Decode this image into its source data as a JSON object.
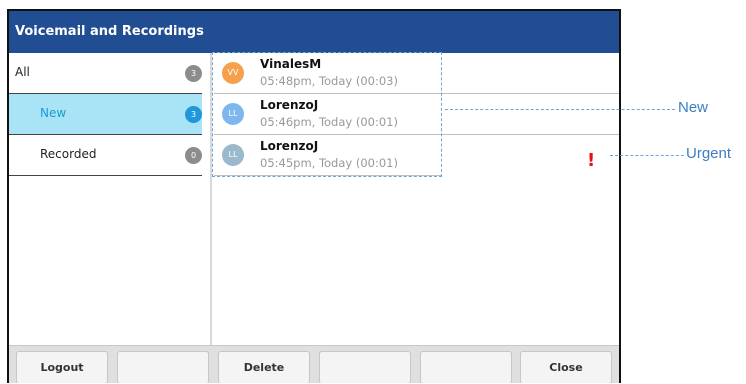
{
  "title": "Voicemail and Recordings",
  "sidebar": {
    "items": [
      {
        "label": "All",
        "count": "3",
        "selected": false
      },
      {
        "label": "New",
        "count": "3",
        "selected": true
      },
      {
        "label": "Recorded",
        "count": "0",
        "selected": false
      }
    ]
  },
  "voicemails": [
    {
      "initials": "VV",
      "name": "VinalesM",
      "time": "05:48pm, Today (00:03)",
      "avatar_color": "#f5a04d",
      "urgent": false
    },
    {
      "initials": "LL",
      "name": "LorenzoJ",
      "time": "05:46pm, Today (00:01)",
      "avatar_color": "#7eb7ee",
      "urgent": false
    },
    {
      "initials": "LL",
      "name": "LorenzoJ",
      "time": "05:45pm, Today (00:01)",
      "avatar_color": "#9bb9cc",
      "urgent": true
    }
  ],
  "urgent_icon": "!",
  "callouts": {
    "new_label": "New",
    "urgent_label": "Urgent"
  },
  "softkeys": [
    "Logout",
    "",
    "Delete",
    "",
    "",
    "Close"
  ],
  "colors": {
    "titlebar": "#214d93",
    "selected_bg": "#a8e4f5",
    "selected_text": "#1a9ad6",
    "urgent": "#e01010",
    "callout": "#3d7ec1"
  }
}
